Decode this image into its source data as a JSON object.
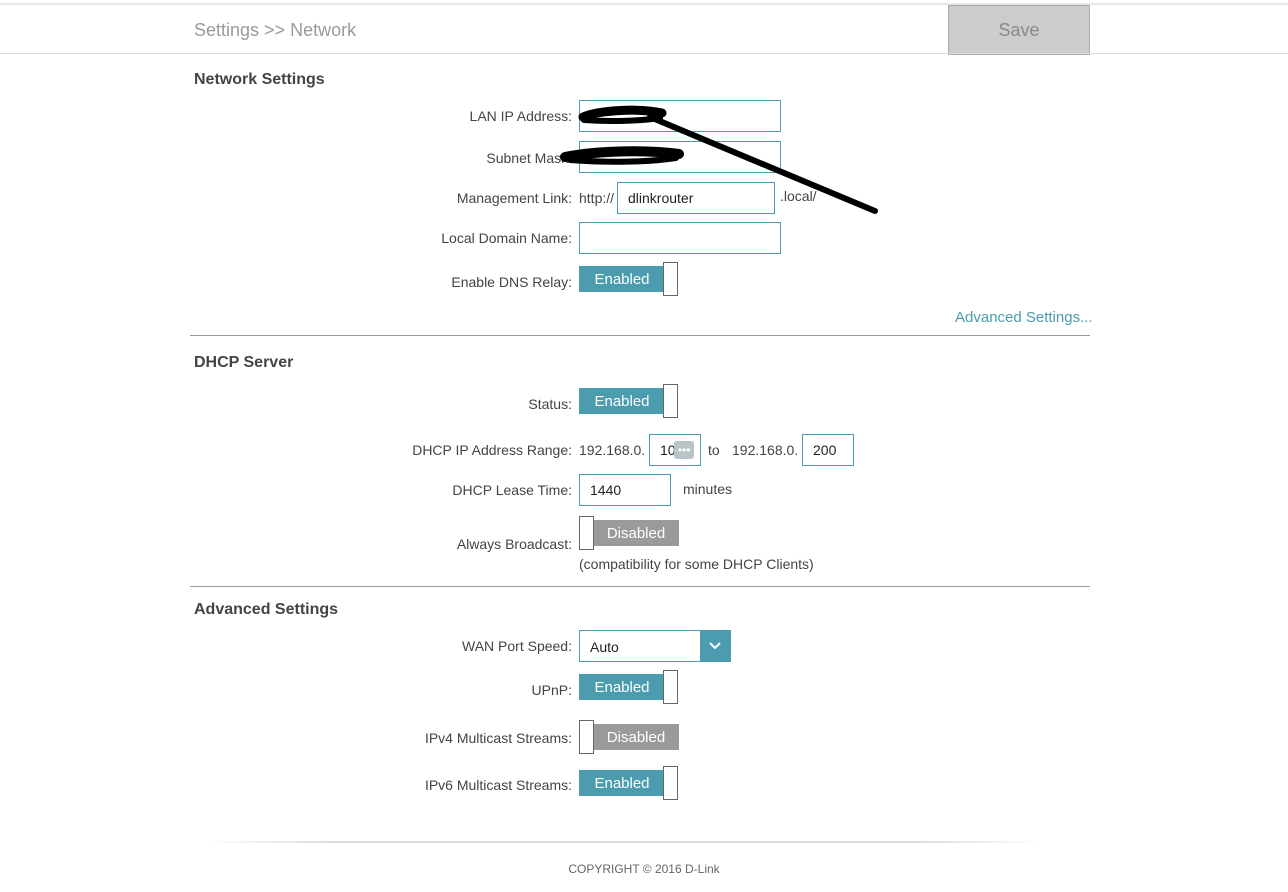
{
  "header": {
    "breadcrumb": "Settings >> Network",
    "save_label": "Save"
  },
  "network_settings": {
    "title": "Network Settings",
    "lan_ip_label": "LAN IP Address:",
    "lan_ip_value": "",
    "subnet_mask_label": "Subnet Mask:",
    "subnet_mask_value": "",
    "management_link_label": "Management Link:",
    "management_prefix": "http://",
    "management_value": "dlinkrouter",
    "management_suffix": ".local/",
    "local_domain_label": "Local Domain Name:",
    "local_domain_value": "",
    "dns_relay_label": "Enable DNS Relay:",
    "dns_relay_state": "Enabled",
    "advanced_link": "Advanced Settings..."
  },
  "dhcp_server": {
    "title": "DHCP Server",
    "status_label": "Status:",
    "status_state": "Enabled",
    "range_label": "DHCP IP Address Range:",
    "range_prefix_start": "192.168.0.",
    "range_start": "10",
    "range_to": "to",
    "range_prefix_end": "192.168.0.",
    "range_end": "200",
    "lease_label": "DHCP Lease Time:",
    "lease_value": "1440",
    "lease_unit": "minutes",
    "broadcast_label": "Always Broadcast:",
    "broadcast_state": "Disabled",
    "broadcast_note": "(compatibility for some DHCP Clients)"
  },
  "advanced_settings": {
    "title": "Advanced Settings",
    "wan_speed_label": "WAN Port Speed:",
    "wan_speed_value": "Auto",
    "upnp_label": "UPnP:",
    "upnp_state": "Enabled",
    "ipv4_multicast_label": "IPv4 Multicast Streams:",
    "ipv4_multicast_state": "Disabled",
    "ipv6_multicast_label": "IPv6 Multicast Streams:",
    "ipv6_multicast_state": "Enabled"
  },
  "footer": {
    "copyright": "COPYRIGHT © 2016 D-Link"
  },
  "colors": {
    "accent": "#4a9cae",
    "disabled": "#9a9a9a",
    "save_bg": "#cccccc"
  },
  "icons": {
    "dropdown": "chevron-down-icon",
    "more": "ellipsis-icon"
  }
}
